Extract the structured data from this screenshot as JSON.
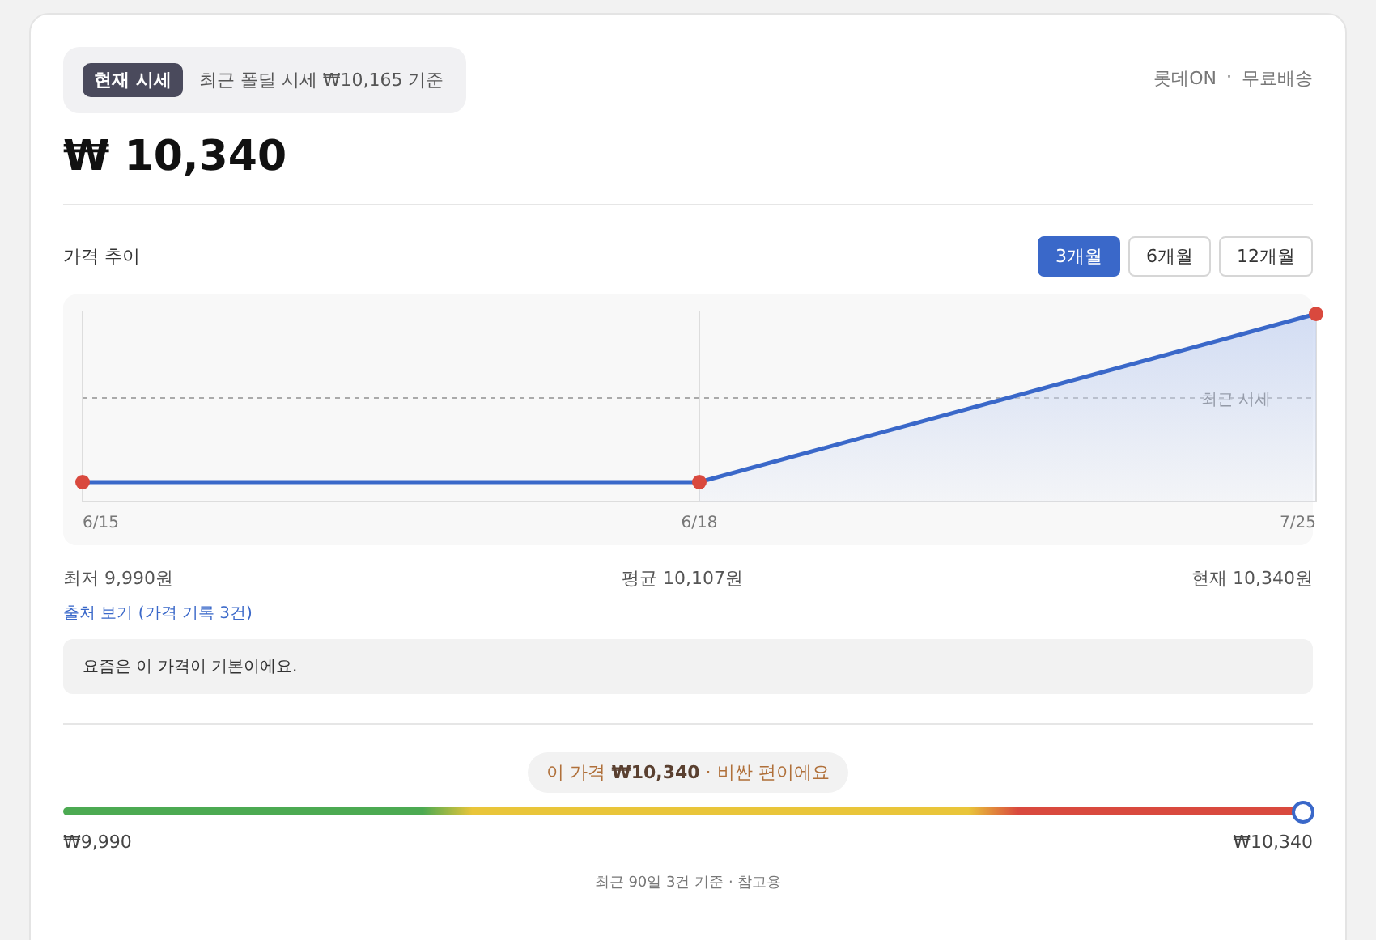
{
  "header": {
    "badge": "현재 시세",
    "note": "최근 폴딜 시세 ₩10,165 기준",
    "seller": "롯데ON",
    "separator": "·",
    "shipping": "무료배송",
    "price": "₩ 10,340"
  },
  "trend": {
    "title": "가격 추이",
    "periods": [
      {
        "label": "3개월",
        "selected": true
      },
      {
        "label": "6개월",
        "selected": false
      },
      {
        "label": "12개월",
        "selected": false
      }
    ],
    "reference_label": "최근 시세",
    "x_labels": [
      "6/15",
      "6/18",
      "7/25"
    ],
    "stats": [
      "최저 9,990원",
      "평균 10,107원",
      "현재 10,340원"
    ],
    "source_link": "출처 보기 (가격 기록 3건)",
    "comment": "요즘은 이 가격이 기본이에요."
  },
  "range": {
    "bubble": "이 가격 **₩10,340** · 비싼 편이에요",
    "level": 1,
    "min": "₩9,990",
    "max": "₩10,340",
    "footnote": "최근 90일 3건 기준 · 참고용"
  }
}
